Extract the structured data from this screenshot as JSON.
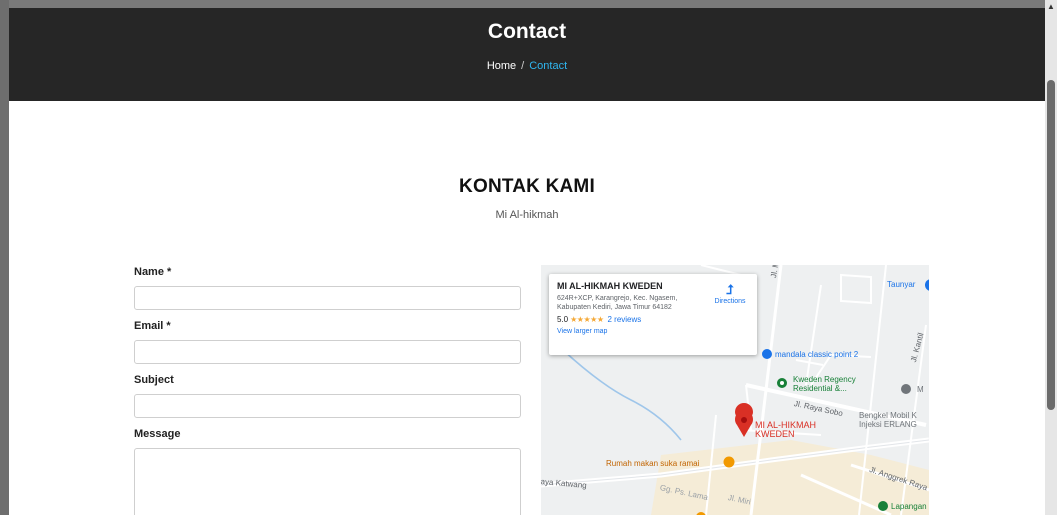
{
  "hero": {
    "title": "Contact",
    "breadcrumb_home": "Home",
    "breadcrumb_separator": "/",
    "breadcrumb_current": "Contact"
  },
  "section": {
    "title": "KONTAK KAMI",
    "subtitle": "Mi Al-hikmah"
  },
  "form": {
    "name_label": "Name *",
    "email_label": "Email *",
    "subject_label": "Subject",
    "message_label": "Message",
    "name_value": "",
    "email_value": "",
    "subject_value": "",
    "message_value": ""
  },
  "map": {
    "place_name": "MI AL-HIKMAH KWEDEN",
    "address": "624R+XCP, Karangrejo, Kec. Ngasem, Kabupaten Kediri, Jawa Timur 64182",
    "rating": "5.0",
    "stars": "★★★★★",
    "reviews": "2 reviews",
    "view_larger": "View larger map",
    "directions": "Directions",
    "labels": {
      "taunyar": "Taunyar",
      "jl_masjid": "Jl. Masjid",
      "jl_kantil": "Jl. Kantil",
      "mandala": "mandala classic point 2",
      "kweden_regency_1": "Kweden Regency",
      "kweden_regency_2": "Residential &...",
      "jl_raya_sobo": "Jl. Raya Sobo",
      "bengkel_1": "Bengkel Mobil K",
      "bengkel_2": "Injeksi ERLANG",
      "mi_marker_1": "MI AL-HIKMAH",
      "mi_marker_2": "KWEDEN",
      "rumah_makan": "Rumah makan suka ramai",
      "jl_raya_katwang": "aya Katwang",
      "gg_ps_lama": "Gg. Ps. Lama",
      "jl_miri": "Jl. Miri",
      "jl_anggrek": "Jl. Anggrek Raya",
      "lapangan": "Lapangan",
      "m_partial": "M"
    }
  },
  "colors": {
    "hero_bg": "#262626",
    "breadcrumb_active": "#2fb6f0",
    "link_blue": "#1a73e8",
    "marker_red": "#d93025",
    "star_orange": "#f4a836"
  }
}
